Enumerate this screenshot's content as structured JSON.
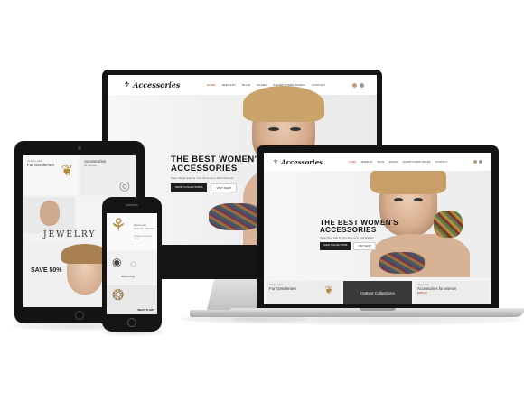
{
  "site": {
    "logo": "Accessories",
    "nav": [
      "HOME",
      "JEWELRY",
      "BLOG",
      "PAGES",
      "SHORTCODES PAGES",
      "CONTACT"
    ],
    "hero_title_line1": "THE BEST WOMEN'S",
    "hero_title_line2": "ACCESSORIES",
    "hero_subtitle": "Super Mega Sale for Your Store up to 40% Discount",
    "btn_primary": "SHOP COLLECTIONS",
    "btn_secondary": "VISIT SHOP",
    "tile_gentlemen_small": "Sarah Logan",
    "tile_gentlemen": "For Gentlemen",
    "tile_collections": "Hottest Collections",
    "tile_accessories_small": "Super Sale",
    "tile_accessories": "Accessories for women",
    "tile_price": "$285.00"
  },
  "tablet": {
    "tile1_small": "Jewelry Elan",
    "tile1": "For Gentlemen",
    "tile2": "Accessories",
    "tile2_sub": "for women",
    "jewelry_word": "JEWELRY",
    "sale": "SAVE 50%"
  },
  "phone": {
    "line1": "Sweet Lovely",
    "line2": "Crossbody Collections",
    "line3": "Coming new items soon",
    "discovery": "discovery",
    "whats_hot": "WHAT'S HOT"
  },
  "colors": {
    "accent": "#c0392b",
    "dark": "#1e1e1e",
    "panel": "#3a3a3a"
  }
}
